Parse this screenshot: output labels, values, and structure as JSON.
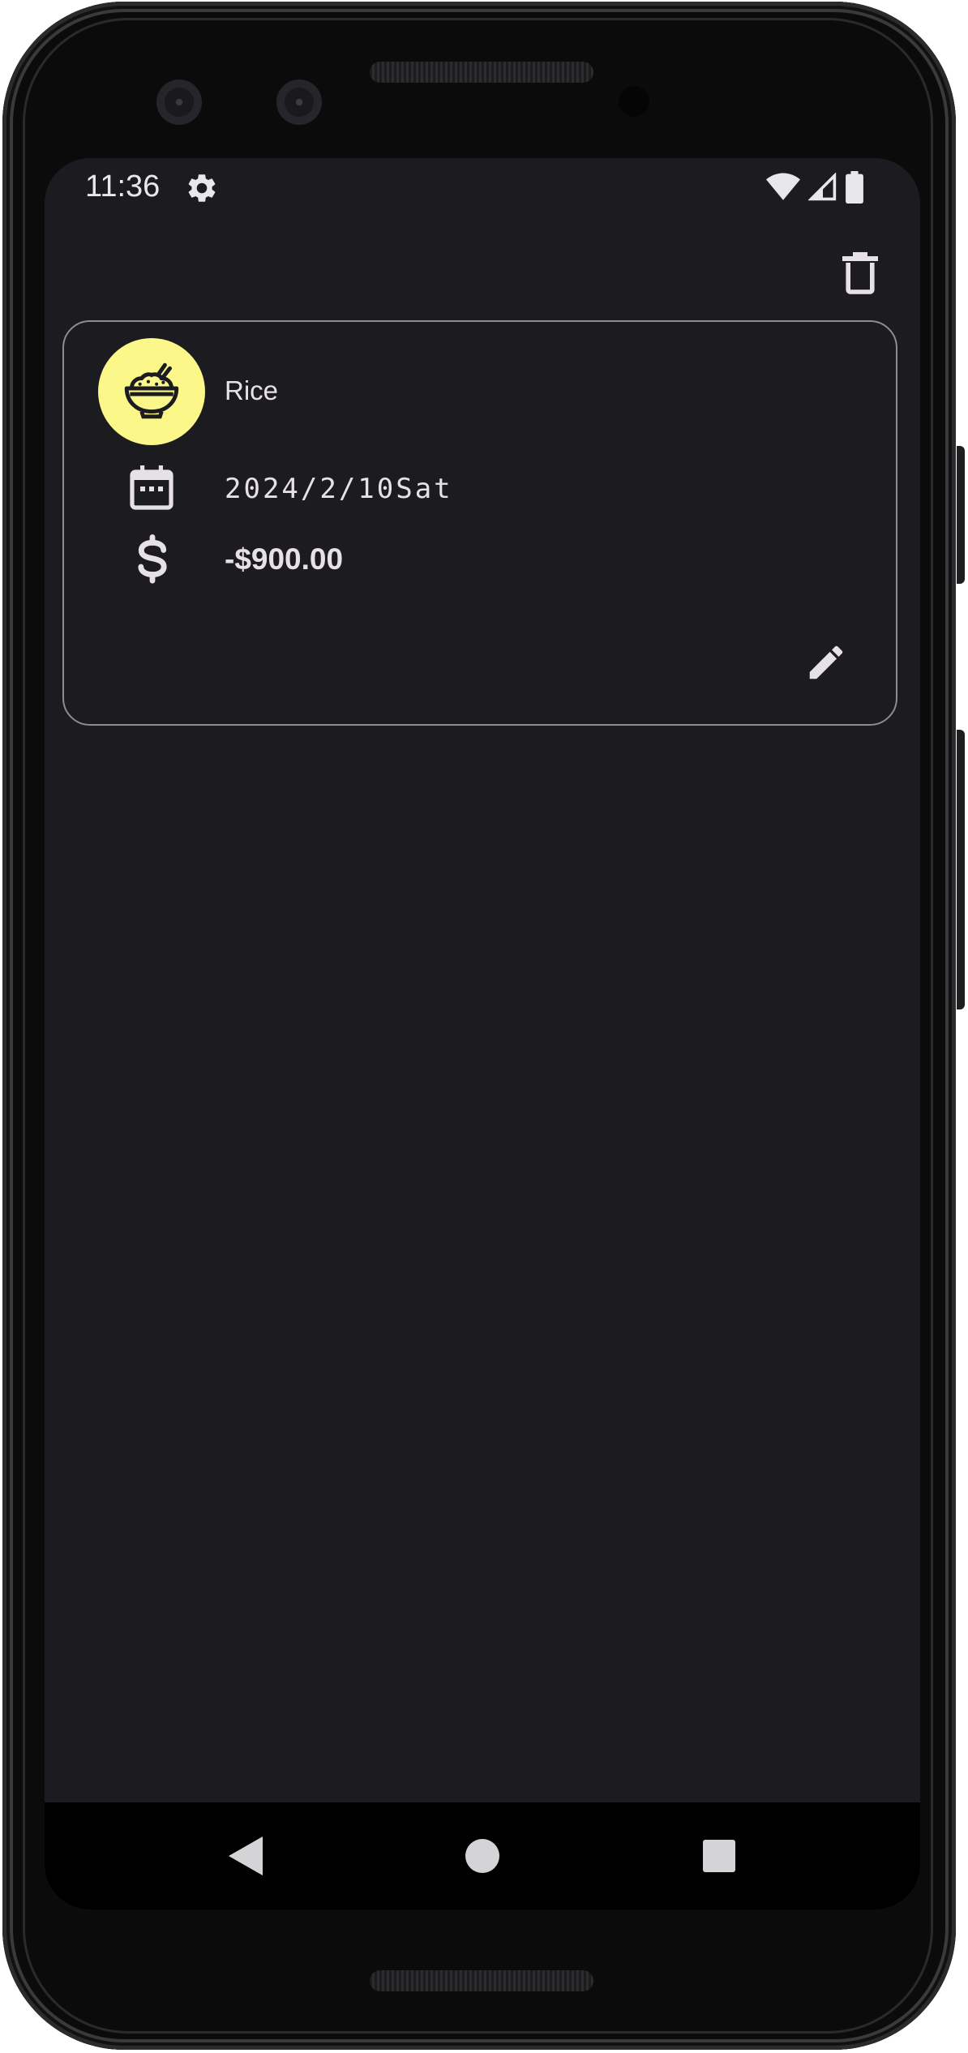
{
  "status_bar": {
    "time": "11:36",
    "icons": [
      "gear-icon",
      "wifi-icon",
      "signal-icon",
      "battery-icon"
    ]
  },
  "toolbar": {
    "delete_icon": "trash-icon"
  },
  "transaction": {
    "category": "Rice",
    "category_icon": "rice-bowl-icon",
    "category_color": "#fbf889",
    "date": "2024/2/10Sat",
    "amount": "-$900.00",
    "edit_icon": "pencil-icon"
  },
  "navigation": {
    "buttons": [
      "back",
      "home",
      "recents"
    ]
  },
  "colors": {
    "background": "#1c1b1f",
    "card_border": "#8e8c93",
    "text": "#e6e1e5"
  }
}
